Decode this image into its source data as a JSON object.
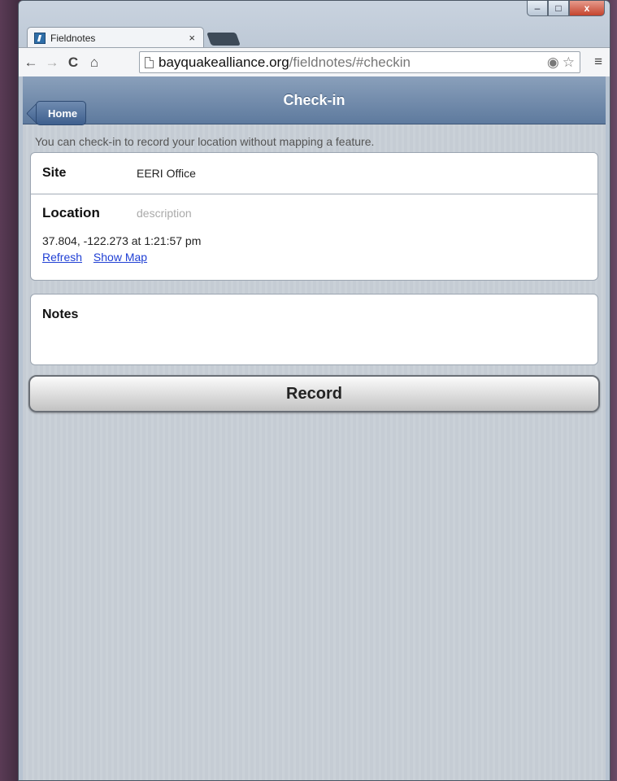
{
  "browser": {
    "tab_title": "Fieldnotes",
    "tab_close": "×",
    "url_host": "bayquakealliance.org",
    "url_path": "/fieldnotes/#checkin",
    "icons": {
      "back": "←",
      "forward": "→",
      "reload": "C",
      "home": "⌂",
      "location": "◉",
      "star": "☆",
      "menu": "≡"
    },
    "window_controls": {
      "minimize": "‒",
      "maximize": "□",
      "close": "x"
    }
  },
  "header": {
    "home_label": "Home",
    "title": "Check-in"
  },
  "intro_text": "You can check-in to record your location without mapping a feature.",
  "form": {
    "site_label": "Site",
    "site_value": "EERI Office",
    "location_label": "Location",
    "location_placeholder": "description",
    "coords_text": "37.804, -122.273 at 1:21:57 pm",
    "refresh_link": "Refresh",
    "show_map_link": "Show Map",
    "notes_label": "Notes"
  },
  "record_label": "Record",
  "colors": {
    "header_top": "#8aa0bb",
    "header_bottom": "#5e7a9e",
    "link": "#1f3fd4"
  }
}
